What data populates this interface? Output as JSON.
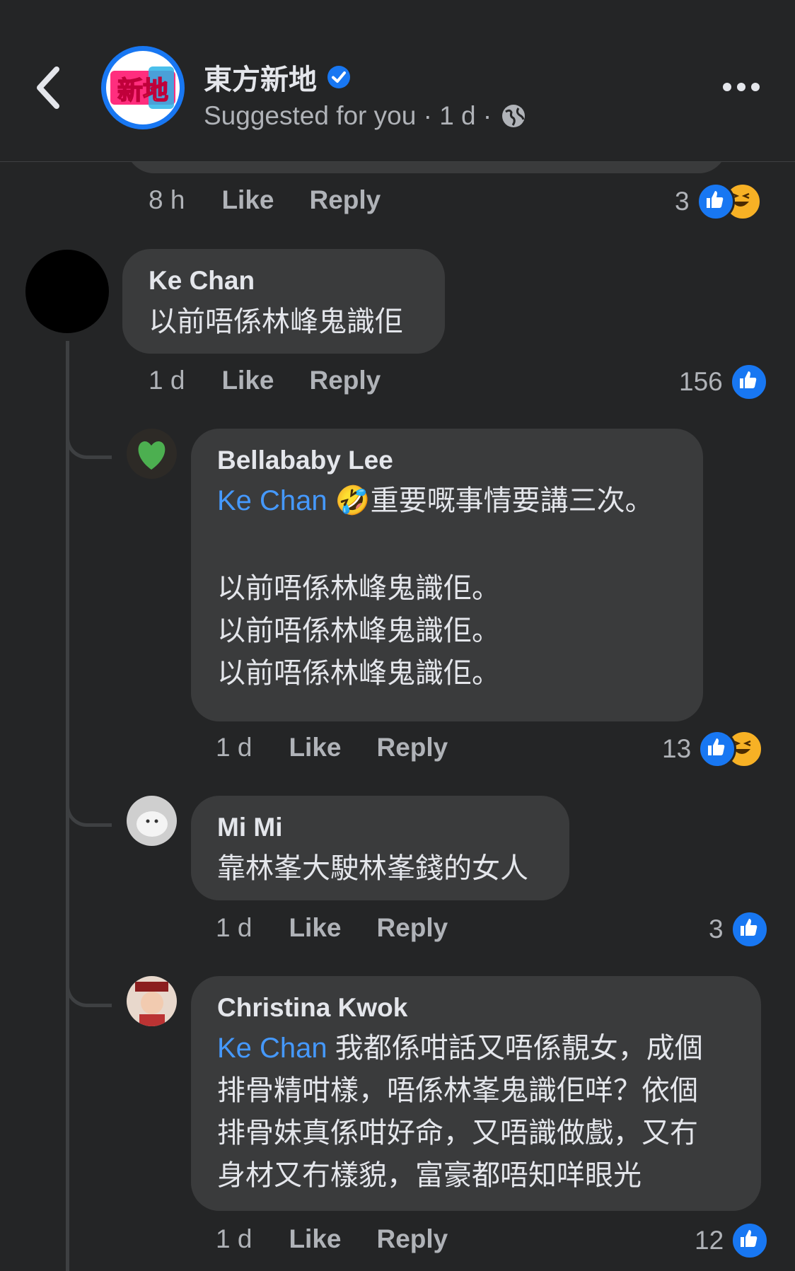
{
  "header": {
    "page_name": "東方新地",
    "meta": "Suggested for you · 1 d ·",
    "logo_text": "新地",
    "icons": {
      "back": "chevron-left-icon",
      "verified": "verified-badge-icon",
      "audience": "globe-icon",
      "more": "more-dots-icon"
    }
  },
  "colors": {
    "background": "#242526",
    "bubble": "#3a3b3c",
    "mention": "#4599ff",
    "like_blue": "#1877f2",
    "haha_yellow": "#f7b125",
    "secondary_text": "#b0b3b8"
  },
  "prev_comment": {
    "time": "8 h",
    "like": "Like",
    "reply": "Reply",
    "reaction_count": "3"
  },
  "comments": [
    {
      "author": "Ke Chan",
      "text": "以前唔係林峰鬼識佢",
      "time": "1 d",
      "like": "Like",
      "reply": "Reply",
      "reaction_count": "156"
    },
    {
      "author": "Bellababy Lee",
      "mention": "Ke Chan",
      "emoji": "🤣",
      "line1": "重要嘅事情要講三次。",
      "line2": "以前唔係林峰鬼識佢。",
      "line3": "以前唔係林峰鬼識佢。",
      "line4": "以前唔係林峰鬼識佢。",
      "time": "1 d",
      "like": "Like",
      "reply": "Reply",
      "reaction_count": "13"
    },
    {
      "author": "Mi Mi",
      "text": "靠林峯大駛林峯錢的女人",
      "time": "1 d",
      "like": "Like",
      "reply": "Reply",
      "reaction_count": "3"
    },
    {
      "author": "Christina Kwok",
      "mention": "Ke Chan",
      "line1": "我都係咁話又唔係靚女，成個",
      "line2": "排骨精咁樣，唔係林峯鬼識佢咩？依個",
      "line3": "排骨妹真係咁好命，又唔識做戲，又冇",
      "line4": "身材又冇樣貌，富豪都唔知咩眼光",
      "time": "1 d",
      "like": "Like",
      "reply": "Reply",
      "reaction_count": "12"
    }
  ]
}
